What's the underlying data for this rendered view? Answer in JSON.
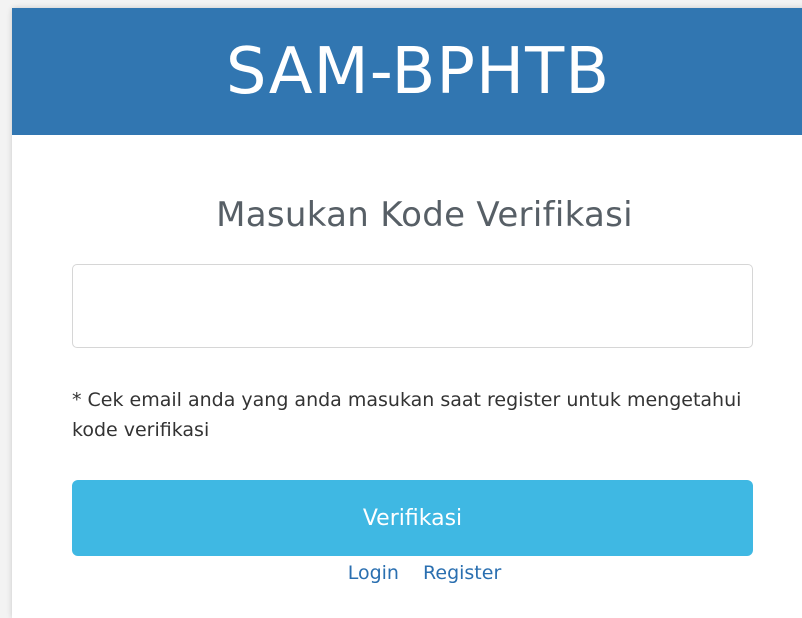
{
  "header": {
    "app_title": "SAM-BPHTB"
  },
  "form": {
    "title": "Masukan Kode Verifikasi",
    "code_input": {
      "value": "",
      "placeholder": ""
    },
    "hint": "* Cek email anda yang anda masukan saat register untuk mengetahui kode verifikasi",
    "submit_label": "Verifikasi"
  },
  "links": {
    "login": "Login",
    "register": "Register"
  },
  "colors": {
    "header_bg": "#3176b1",
    "button_bg": "#3fb8e3",
    "link": "#2a6fb0"
  }
}
